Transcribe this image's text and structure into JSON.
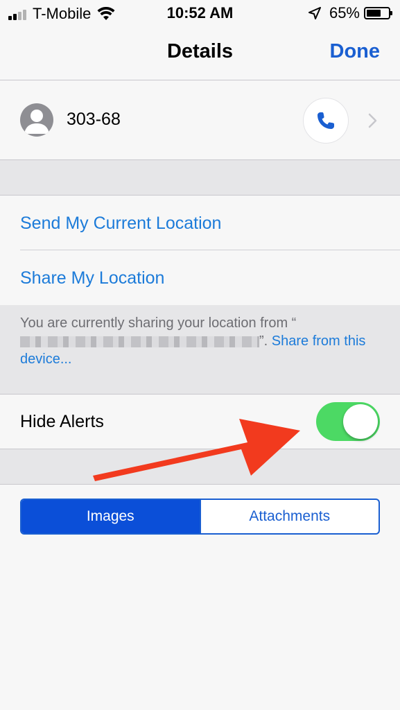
{
  "status_bar": {
    "carrier": "T-Mobile",
    "time": "10:52 AM",
    "battery_percent": "65%",
    "battery_level": 0.65,
    "icons": [
      "signal-icon",
      "wifi-icon",
      "location-arrow-icon",
      "battery-icon"
    ]
  },
  "nav": {
    "title": "Details",
    "done_label": "Done"
  },
  "contact": {
    "name": "303-68",
    "icons": [
      "avatar-icon",
      "phone-icon",
      "chevron-right-icon"
    ]
  },
  "location": {
    "send_label": "Send My Current Location",
    "share_label": "Share My Location",
    "note_prefix": "You are currently sharing your location from “",
    "note_suffix": "”.",
    "note_link": "Share from this device..."
  },
  "alerts": {
    "label": "Hide Alerts",
    "toggle_on": true
  },
  "segments": {
    "images_label": "Images",
    "attachments_label": "Attachments",
    "selected": "Images"
  },
  "colors": {
    "accent": "#1a5fd1",
    "link": "#1c7bd9",
    "toggle_on": "#4cd964",
    "annotation_arrow": "#f23a1e"
  }
}
